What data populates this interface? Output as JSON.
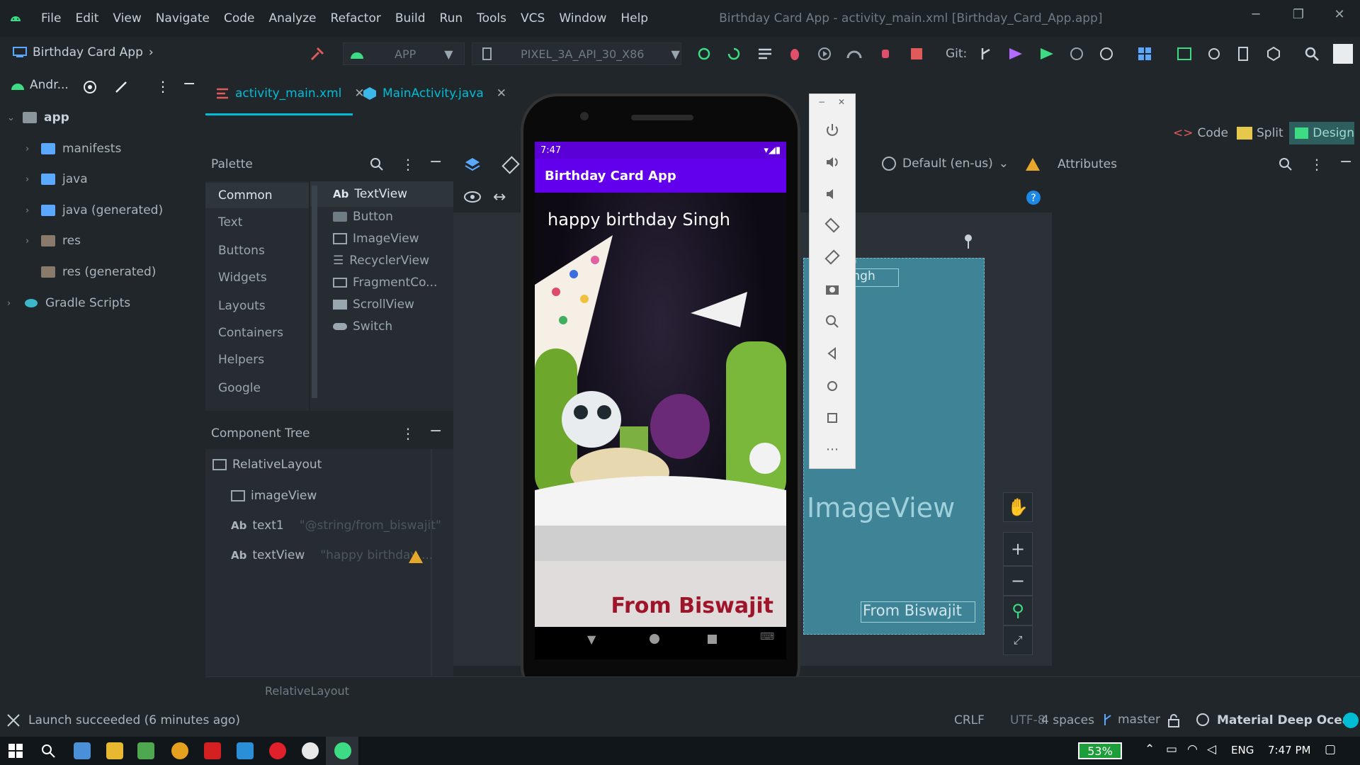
{
  "menu": {
    "items": [
      "File",
      "Edit",
      "View",
      "Navigate",
      "Code",
      "Analyze",
      "Refactor",
      "Build",
      "Run",
      "Tools",
      "VCS",
      "Window",
      "Help"
    ],
    "window_title": "Birthday Card App - activity_main.xml [Birthday_Card_App.app]"
  },
  "toolbar": {
    "project_name": "Birthday Card App",
    "run_config": "APP",
    "device": "PIXEL_3A_API_30_X86",
    "git_label": "Git:"
  },
  "project_panel": {
    "view_label": "Andr...",
    "tree": [
      {
        "label": "app",
        "level": 0,
        "expanded": true
      },
      {
        "label": "manifests",
        "level": 1
      },
      {
        "label": "java",
        "level": 1
      },
      {
        "label": "java (generated)",
        "level": 1
      },
      {
        "label": "res",
        "level": 1
      },
      {
        "label": "res (generated)",
        "level": 1
      },
      {
        "label": "Gradle Scripts",
        "level": 0
      }
    ]
  },
  "tabs": [
    {
      "label": "activity_main.xml",
      "active": true
    },
    {
      "label": "MainActivity.java",
      "active": false
    }
  ],
  "view_modes": {
    "code": "Code",
    "split": "Split",
    "design": "Design"
  },
  "palette": {
    "title": "Palette",
    "categories": [
      "Common",
      "Text",
      "Buttons",
      "Widgets",
      "Layouts",
      "Containers",
      "Helpers",
      "Google"
    ],
    "widgets": [
      "TextView",
      "Button",
      "ImageView",
      "RecyclerView",
      "FragmentCo...",
      "ScrollView",
      "Switch"
    ]
  },
  "locale": "Default (en-us)",
  "attributes_title": "Attributes",
  "component_tree": {
    "title": "Component Tree",
    "root": "RelativeLayout",
    "children": [
      {
        "name": "imageView",
        "hint": ""
      },
      {
        "name": "text1",
        "hint": "\"@string/from_biswajit\""
      },
      {
        "name": "textView",
        "hint": "\"happy birthday ..."
      }
    ]
  },
  "blueprint": {
    "image_label": "ImageView",
    "text_top": "ay Singh",
    "text_bottom": "From Biswajit",
    "margin": "20"
  },
  "phone": {
    "time": "7:47",
    "app_title": "Birthday Card App",
    "greeting": "happy birthday Singh",
    "signature": "From Biswajit"
  },
  "breadcrumb": "RelativeLayout",
  "status": {
    "message": "Launch succeeded (6 minutes ago)",
    "line_ending": "CRLF",
    "encoding": "UTF-8",
    "indent": "4 spaces",
    "branch": "master",
    "theme": "Material Deep Ocean"
  },
  "taskbar": {
    "battery": "53%",
    "language": "ENG",
    "clock": "7:47 PM"
  },
  "colors": {
    "app_bar": "#6200ee",
    "status_bar": "#5b00d6",
    "signature": "#a0142a",
    "blueprint": "#3f8396",
    "accent": "#00bcd4"
  }
}
